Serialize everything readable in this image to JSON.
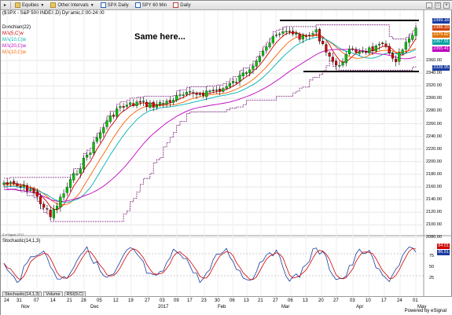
{
  "toolbar": {
    "items": [
      "Equities",
      "Other Intervals",
      "SPX Daily",
      "SPY 60 Min",
      "Daily"
    ]
  },
  "header": {
    "symbol_line": "($SPX - S&P 500 INDEX,D) Dynamic,0:00-24:00"
  },
  "legend": {
    "items": [
      {
        "label": "Donchian(22)",
        "color": "#000000"
      },
      {
        "label": "MA(5,C)w",
        "color": "#d00000"
      },
      {
        "label": "MA(10,C)w",
        "color": "#00b0b0"
      },
      {
        "label": "MA(20,C)w",
        "color": "#c000c0"
      },
      {
        "label": "MA(10,C)w",
        "color": "#ff6000"
      }
    ]
  },
  "annotation": "Same here...",
  "price_axis": [
    "2360.00",
    "2340.00",
    "2320.00",
    "2300.00",
    "2280.00",
    "2260.00",
    "2240.00",
    "2220.00",
    "2200.00",
    "2180.00",
    "2160.00",
    "2140.00",
    "2120.00",
    "2100.00",
    "2080.00"
  ],
  "price_tags": [
    {
      "text": "2399.18",
      "color": "#1a3aa0"
    },
    {
      "text": "2388.33",
      "color": "#d04000"
    },
    {
      "text": "2379.82",
      "color": "#e07000"
    },
    {
      "text": "2367.91",
      "color": "#00a0a0"
    },
    {
      "text": "2355.41",
      "color": "#c000c0"
    },
    {
      "text": "2328.95",
      "color": "#1a3aa0"
    }
  ],
  "indicator": {
    "title": "Stochastic(14,1,3)",
    "axis": [
      "75",
      "50",
      "25"
    ],
    "tags": [
      {
        "text": "84.01",
        "color": "#d00000"
      },
      {
        "text": "86.51",
        "color": "#1a3aa0"
      }
    ]
  },
  "bottom_tabs": [
    "Stochastic(14,1,3)",
    "Volume",
    "RSI(9,C)"
  ],
  "date_axis": {
    "days": [
      "24",
      "31",
      "07",
      "14",
      "21",
      "28",
      "05",
      "12",
      "19",
      "27",
      "03",
      "09",
      "17",
      "23",
      "30",
      "06",
      "13",
      "21",
      "27",
      "06",
      "13",
      "20",
      "27",
      "03",
      "10",
      "17",
      "24",
      "01"
    ],
    "months": [
      "Nov",
      "Dec",
      "2017",
      "Feb",
      "Mar",
      "Apr",
      "May"
    ]
  },
  "footer": {
    "esignal": "Powered by eSignal",
    "copyright": "© eSignal 2017"
  }
}
